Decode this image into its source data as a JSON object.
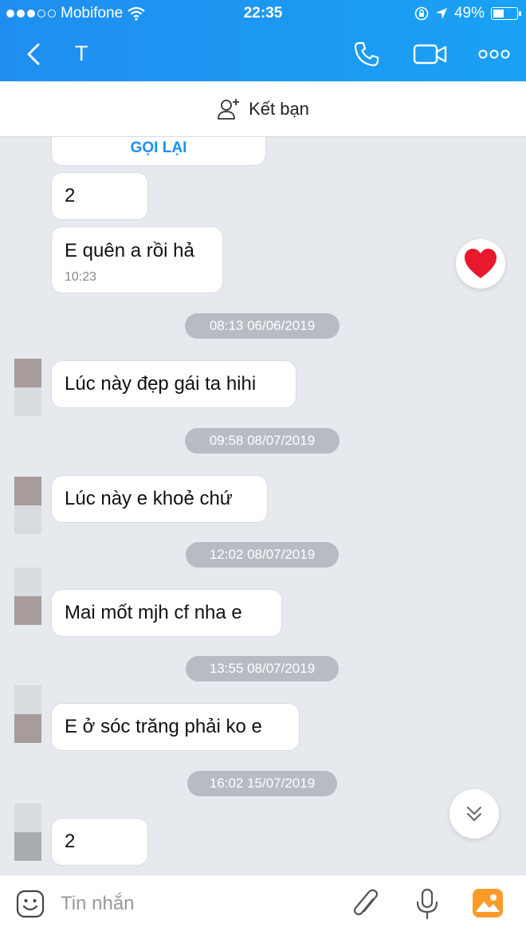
{
  "status": {
    "carrier": "Mobifone",
    "time": "22:35",
    "battery": "49%",
    "battery_level": 0.49
  },
  "header": {
    "title": "T"
  },
  "friend_bar": {
    "label": "Kết bạn"
  },
  "chat": {
    "callback_label": "GỌI LẠI",
    "messages": [
      {
        "text": "2"
      },
      {
        "text": "E quên a rồi hả",
        "time": "10:23"
      },
      {
        "text": "Lúc này đẹp gái ta hihi"
      },
      {
        "text": "Lúc này e khoẻ chứ"
      },
      {
        "text": "Mai mốt mjh cf nha e"
      },
      {
        "text": "E ở sóc trăng phải ko e"
      },
      {
        "text": "2"
      }
    ],
    "timestamps": [
      "08:13 06/06/2019",
      "09:58 08/07/2019",
      "12:02 08/07/2019",
      "13:55 08/07/2019",
      "16:02 15/07/2019"
    ]
  },
  "composer": {
    "placeholder": "Tin nhắn"
  },
  "colors": {
    "header": "#1f8ef0",
    "accent": "#1a8ff0",
    "heart": "#e8192c",
    "chat_bg": "#e6e9ee"
  }
}
